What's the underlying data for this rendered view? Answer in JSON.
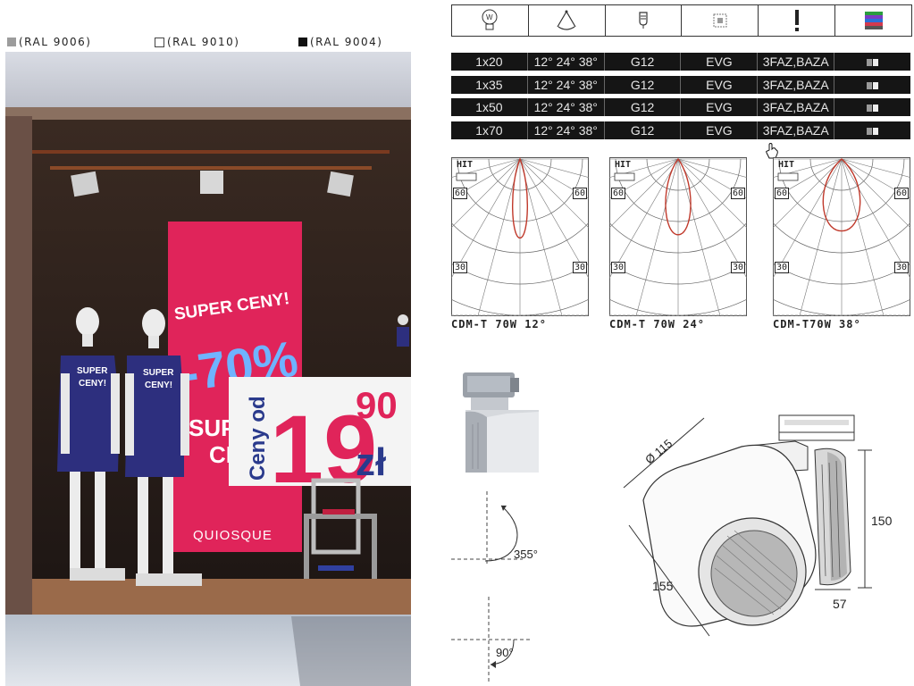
{
  "swatches": [
    {
      "label": "(RAL 9006)",
      "color": "#9c9c9c"
    },
    {
      "label": "(RAL 9010)",
      "color": "#ffffff"
    },
    {
      "label": "(RAL 9004)",
      "color": "#111111"
    }
  ],
  "photo": {
    "poster_text_1": "SUPER CENY!",
    "poster_text_2": "-70%",
    "poster_text_3": "SUPER",
    "poster_text_4": "CE",
    "poster_brand": "QUIOSQUE",
    "price_prefix": "Ceny od",
    "price_main": "19",
    "price_cents": "90",
    "price_currency": "zł",
    "shirt_text": "SUPER CENY!",
    "colors": {
      "poster": "#e0245a",
      "shirt": "#2d2f7e"
    }
  },
  "icon_header": [
    "wattage-bulb-icon",
    "beam-angle-icon",
    "socket-icon",
    "ballast-icon",
    "warning-icon",
    "color-options-icon"
  ],
  "spec_rows": [
    {
      "power": "1x20",
      "angles": "12°  24°  38°",
      "socket": "G12",
      "ballast": "EVG",
      "adapter": "3FAZ,BAZA"
    },
    {
      "power": "1x35",
      "angles": "12°  24°  38°",
      "socket": "G12",
      "ballast": "EVG",
      "adapter": "3FAZ,BAZA"
    },
    {
      "power": "1x50",
      "angles": "12°  24°  38°",
      "socket": "G12",
      "ballast": "EVG",
      "adapter": "3FAZ,BAZA"
    },
    {
      "power": "1x70",
      "angles": "12°  24°  38°",
      "socket": "G12",
      "ballast": "EVG",
      "adapter": "3FAZ,BAZA"
    }
  ],
  "polar_diagrams": [
    {
      "caption": "CDM-T 70W 12°",
      "hit": "HIT",
      "angle_60": "60",
      "angle_30": "30",
      "beam_deg": 12
    },
    {
      "caption": "CDM-T 70W 24°",
      "hit": "HIT",
      "angle_60": "60",
      "angle_30": "30",
      "beam_deg": 24
    },
    {
      "caption": "CDM-T70W 38°",
      "hit": "HIT",
      "angle_60": "60",
      "angle_30": "30",
      "beam_deg": 38
    }
  ],
  "rotation": {
    "pan": "355°",
    "tilt": "90°"
  },
  "dimensions": {
    "diameter": "Ø 115",
    "length": "155",
    "height": "150",
    "depth": "57"
  }
}
